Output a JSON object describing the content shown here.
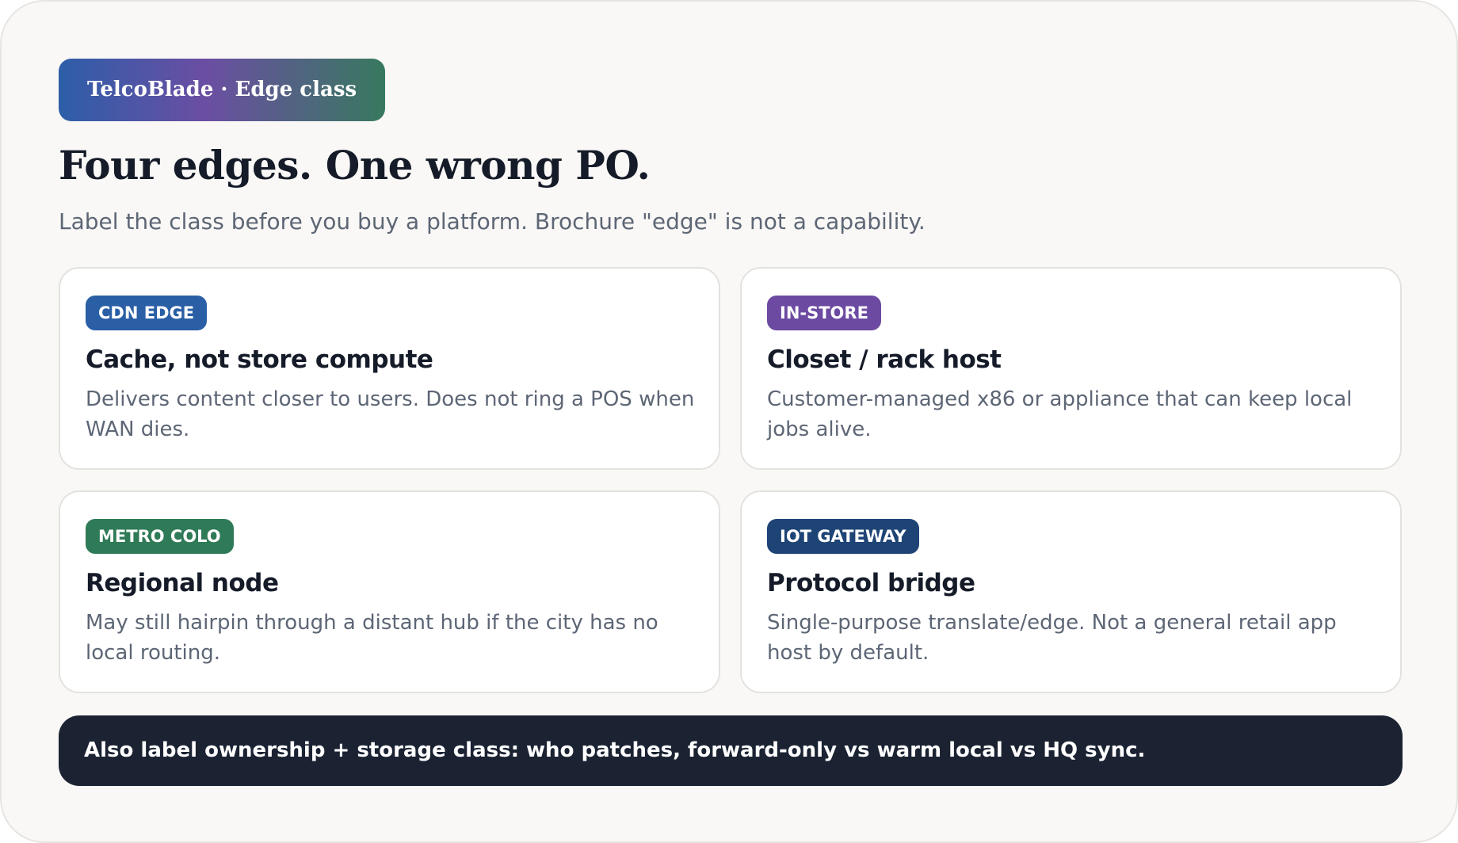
{
  "brand": {
    "label": "TelcoBlade · Edge class",
    "gradient": [
      "#2d5ea8",
      "#6b4ea3",
      "#38795f"
    ]
  },
  "heading": {
    "title": "Four edges. One wrong PO.",
    "subtitle": "Label the class before you buy a platform. Brochure \"edge\" is not a capability."
  },
  "cards": [
    {
      "tag": "CDN EDGE",
      "tag_color": "#2a5fa6",
      "title": "Cache, not store compute",
      "description": "Delivers content closer to users. Does not ring a POS when WAN dies."
    },
    {
      "tag": "IN-STORE",
      "tag_color": "#6c4aa2",
      "title": "Closet / rack host",
      "description": "Customer-managed x86 or appliance that can keep local jobs alive."
    },
    {
      "tag": "METRO COLO",
      "tag_color": "#2f7a57",
      "title": "Regional node",
      "description": "May still hairpin through a distant hub if the city has no local routing."
    },
    {
      "tag": "IOT GATEWAY",
      "tag_color": "#1e4476",
      "title": "Protocol bridge",
      "description": "Single-purpose translate/edge. Not a general retail app host by default."
    }
  ],
  "footer": {
    "note": "Also label ownership + storage class: who patches, forward-only vs warm local vs HQ sync."
  }
}
